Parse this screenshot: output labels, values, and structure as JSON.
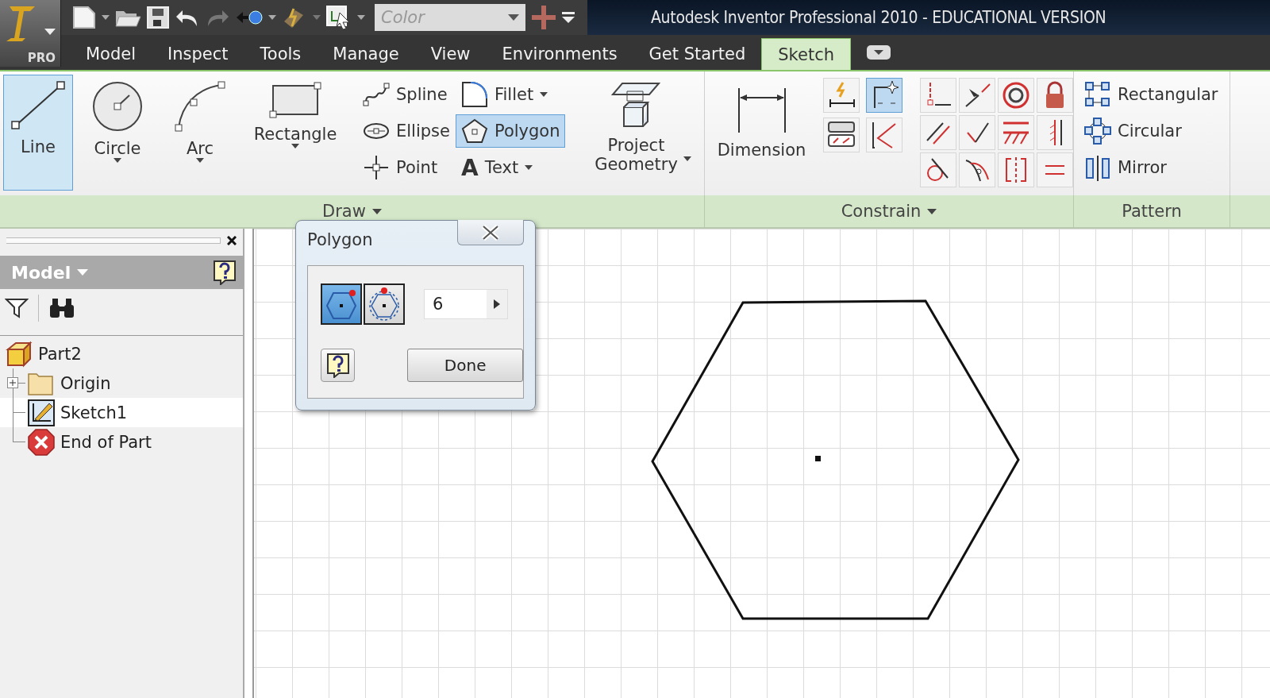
{
  "app_button": {
    "badge": "PRO"
  },
  "quick_access": {
    "style_combo": {
      "value": "Color",
      "disabled": true
    }
  },
  "title": "Autodesk Inventor Professional 2010 - EDUCATIONAL VERSION",
  "tabs": [
    {
      "label": "Model",
      "selected": false
    },
    {
      "label": "Inspect",
      "selected": false
    },
    {
      "label": "Tools",
      "selected": false
    },
    {
      "label": "Manage",
      "selected": false
    },
    {
      "label": "View",
      "selected": false
    },
    {
      "label": "Environments",
      "selected": false
    },
    {
      "label": "Get Started",
      "selected": false
    },
    {
      "label": "Sketch",
      "selected": true
    }
  ],
  "ribbon": {
    "draw": {
      "label": "Draw",
      "has_menu": true,
      "large_tools": [
        {
          "kind": "line",
          "label": "Line",
          "selected": true,
          "has_menu": false
        },
        {
          "kind": "circle",
          "label": "Circle",
          "selected": false,
          "has_menu": true
        },
        {
          "kind": "arc",
          "label": "Arc",
          "selected": false,
          "has_menu": true
        },
        {
          "kind": "rectangle",
          "label": "Rectangle",
          "selected": false,
          "has_menu": true
        }
      ],
      "small_tools": [
        {
          "kind": "spline",
          "label": "Spline",
          "selected": false,
          "has_menu": false
        },
        {
          "kind": "ellipse",
          "label": "Ellipse",
          "selected": false,
          "has_menu": false
        },
        {
          "kind": "point",
          "label": "Point",
          "selected": false,
          "has_menu": false
        },
        {
          "kind": "fillet",
          "label": "Fillet",
          "selected": false,
          "has_menu": true
        },
        {
          "kind": "polygon",
          "label": "Polygon",
          "selected": true,
          "has_menu": false
        },
        {
          "kind": "text",
          "glyph": "A",
          "label": "Text",
          "selected": false,
          "has_menu": true
        }
      ],
      "project_geometry": {
        "label": "Project Geometry",
        "has_menu": true
      }
    },
    "constrain": {
      "label": "Constrain",
      "has_menu": true,
      "dimension": {
        "label": "Dimension"
      },
      "tools": [
        {
          "selected": false
        },
        {
          "selected": true
        },
        {
          "selected": false
        },
        {
          "selected": false
        }
      ]
    },
    "pattern": {
      "label": "Pattern",
      "has_menu": false,
      "tools": [
        {
          "kind": "rectangular",
          "label": "Rectangular"
        },
        {
          "kind": "circular",
          "label": "Circular"
        },
        {
          "kind": "mirror",
          "label": "Mirror"
        }
      ]
    }
  },
  "browser": {
    "title": "Model",
    "tree": [
      {
        "kind": "part",
        "label": "Part2",
        "children": [
          {
            "kind": "folder",
            "label": "Origin",
            "expanded": false
          },
          {
            "kind": "sketch",
            "label": "Sketch1"
          },
          {
            "kind": "end",
            "label": "End of Part"
          }
        ]
      }
    ]
  },
  "dialog": {
    "title": "Polygon",
    "modes": [
      {
        "selected": true
      },
      {
        "selected": false
      }
    ],
    "sides": "6",
    "done": "Done"
  }
}
